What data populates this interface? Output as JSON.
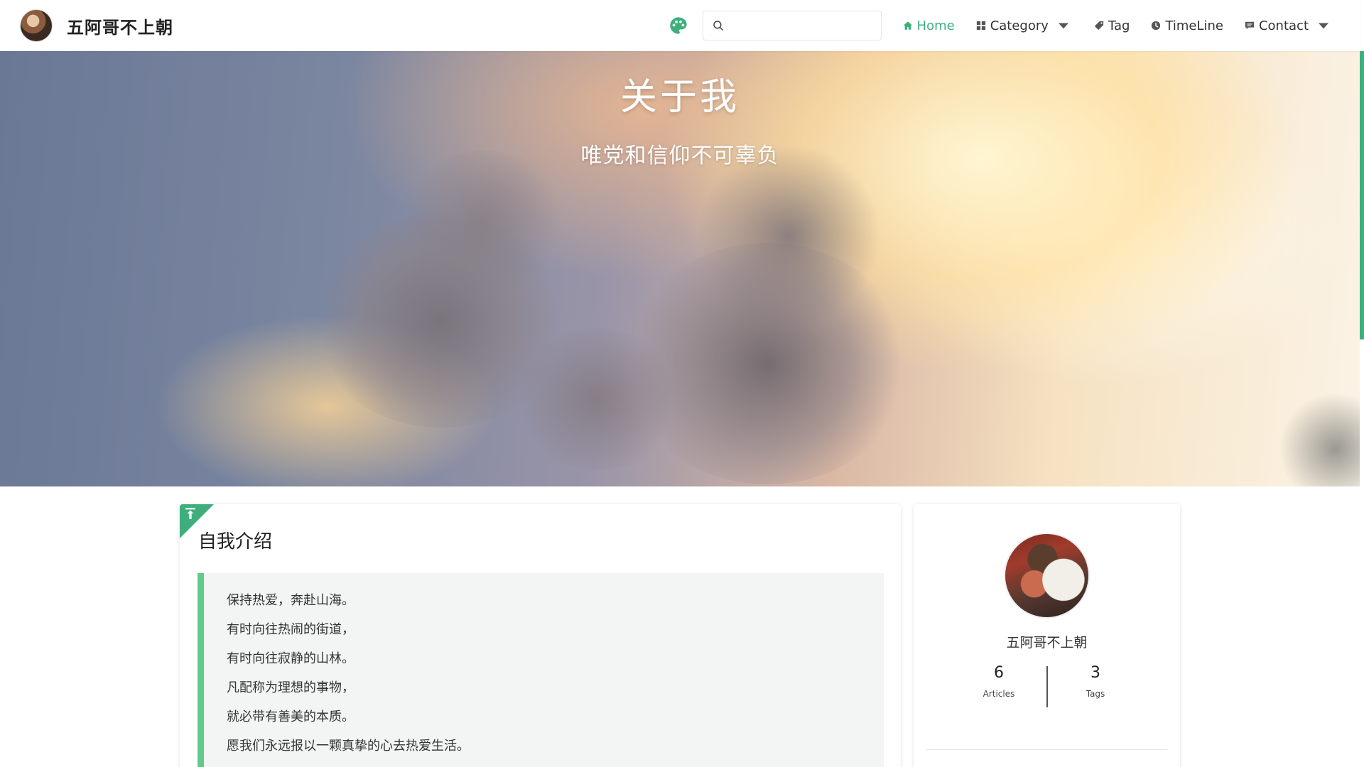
{
  "site": {
    "title": "五阿哥不上朝"
  },
  "nav": {
    "search_placeholder": "",
    "items": [
      {
        "label": "Home",
        "icon": "home-icon",
        "active": true
      },
      {
        "label": "Category",
        "icon": "category-grid-icon",
        "dropdown": true
      },
      {
        "label": "Tag",
        "icon": "tag-icon"
      },
      {
        "label": "TimeLine",
        "icon": "clock-icon"
      },
      {
        "label": "Contact",
        "icon": "message-icon",
        "dropdown": true
      }
    ],
    "theme_icon": "palette-icon"
  },
  "hero": {
    "title": "关于我",
    "subtitle": "唯党和信仰不可辜负"
  },
  "article": {
    "title": "自我介绍",
    "lines": [
      "保持热爱，奔赴山海。",
      "有时向往热闹的街道，",
      "有时向往寂静的山林。",
      "凡配称为理想的事物，",
      "就必带有善美的本质。",
      "愿我们永远报以一颗真挚的心去热爱生活。"
    ]
  },
  "profile": {
    "name": "五阿哥不上朝",
    "articles_count": "6",
    "articles_label": "Articles",
    "tags_count": "3",
    "tags_label": "Tags"
  },
  "colors": {
    "accent": "#3eaf7c",
    "quote_border": "#5fcc8a",
    "quote_bg": "#f3f5f4"
  }
}
